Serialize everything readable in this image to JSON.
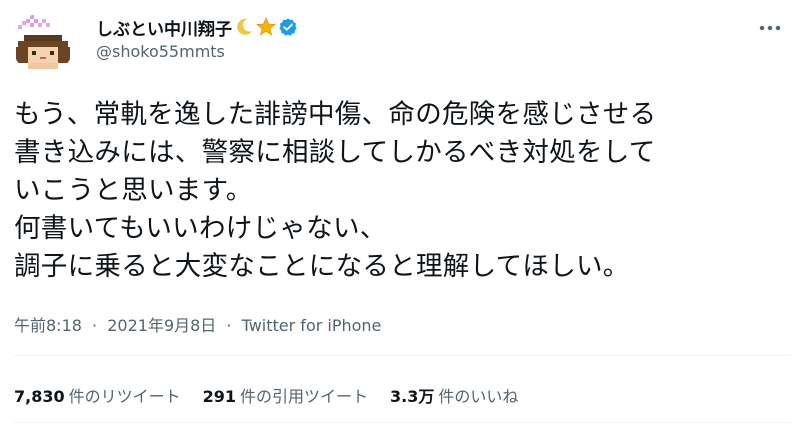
{
  "user": {
    "display_name": "しぶとい中川翔子",
    "handle": "@shoko55mmts",
    "verified": true,
    "name_emojis": [
      "crescent-moon-emoji",
      "star-emoji"
    ]
  },
  "tweet": {
    "text": "もう、常軌を逸した誹謗中傷、命の危険を感じさせる\n書き込みには、警察に相談してしかるべき対処をして\nいこうと思います。\n何書いてもいいわけじゃない、\n調子に乗ると大変なことになると理解してほしい。",
    "time": "午前8:18",
    "separator": "·",
    "date": "2021年9月8日",
    "source": "Twitter for iPhone"
  },
  "stats": {
    "retweets_count": "7,830",
    "retweets_label": "件のリツイート",
    "quotes_count": "291",
    "quotes_label": "件の引用ツイート",
    "likes_count": "3.3万",
    "likes_label": "件のいいね"
  },
  "colors": {
    "text": "#0f1419",
    "secondary": "#536471",
    "verified": "#1d9bf0",
    "divider": "#eff3f4"
  }
}
